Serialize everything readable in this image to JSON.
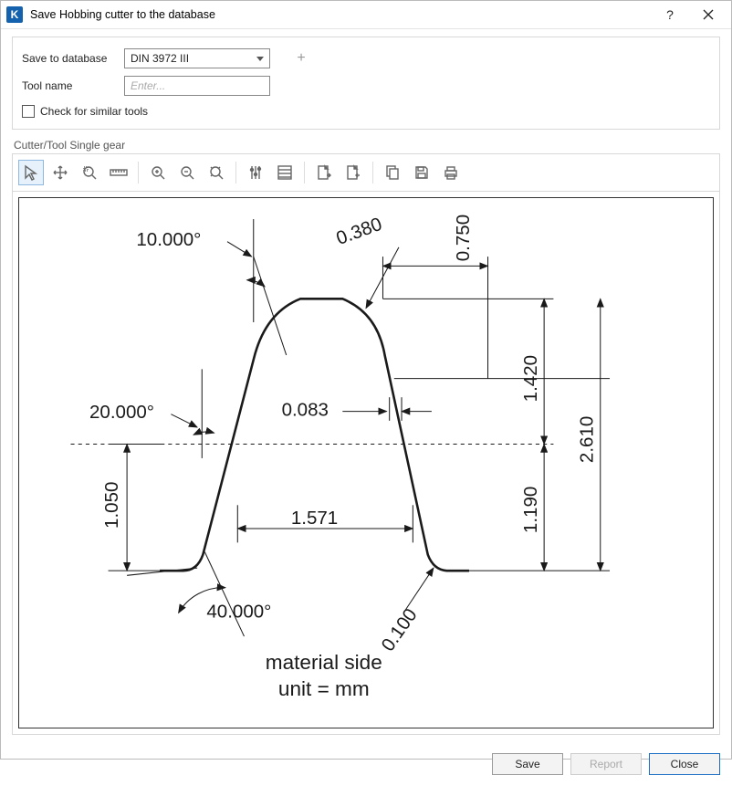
{
  "window": {
    "title": "Save Hobbing cutter to the database"
  },
  "form": {
    "save_to_label": "Save to database",
    "database_selected": "DIN 3972 III",
    "tool_name_label": "Tool name",
    "tool_name_value": "",
    "tool_name_placeholder": "Enter...",
    "check_similar_label": "Check for similar tools"
  },
  "group": {
    "label": "Cutter/Tool Single gear"
  },
  "diagram": {
    "angle_top": "10.000°",
    "angle_mid": "20.000°",
    "angle_bot": "40.000°",
    "tip_radius": "0.380",
    "root_radius": "0.100",
    "offset_083": "0.083",
    "pitch_half": "1.571",
    "h_top_small": "0.750",
    "h_top_section": "1.420",
    "h_bot_section": "1.190",
    "h_total": "2.610",
    "h_left": "1.050",
    "note1": "material side",
    "note2": "unit = mm"
  },
  "footer": {
    "save": "Save",
    "report": "Report",
    "close": "Close"
  },
  "toolbar_icons": [
    "pointer",
    "pan",
    "zoom-window",
    "measure",
    "zoom-in",
    "zoom-out",
    "zoom-fit",
    "sliders",
    "properties",
    "export-1",
    "export-2",
    "copy",
    "save-file",
    "print"
  ]
}
